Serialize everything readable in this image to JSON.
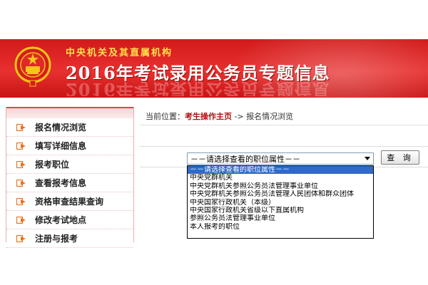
{
  "banner": {
    "subtitle": "中央机关及其直属机构",
    "title": "2016年考试录用公务员专题信息",
    "reflection": "2016年考试录用公务员专题信息"
  },
  "sidebar": {
    "items": [
      {
        "label": "报名情况浏览"
      },
      {
        "label": "填写详细信息"
      },
      {
        "label": "报考职位"
      },
      {
        "label": "查看报考信息"
      },
      {
        "label": "资格审查结果查询"
      },
      {
        "label": "修改考试地点"
      },
      {
        "label": "注册与报考"
      }
    ]
  },
  "breadcrumb": {
    "prefix": "当前位置：",
    "link": "考生操作主页",
    "separator": " -> ",
    "current": "报名情况浏览"
  },
  "filter": {
    "selected": "－－请选择查看的职位属性－－",
    "query_label": "查 询",
    "options": [
      "－－请选择查看的职位属性－－",
      "中央党群机关",
      "中央党群机关参照公务员法管理事业单位",
      "中央党群机关参照公务员法管理人民团体和群众团体",
      "中央国家行政机关（本级）",
      "中央国家行政机关省级以下直属机构",
      "参照公务员法管理事业单位",
      "本人报考的职位"
    ]
  },
  "colors": {
    "banner_red": "#d21a1a",
    "accent_gold": "#ffe14a",
    "icon_orange": "#e8701a",
    "selection_blue": "#3169c6"
  }
}
